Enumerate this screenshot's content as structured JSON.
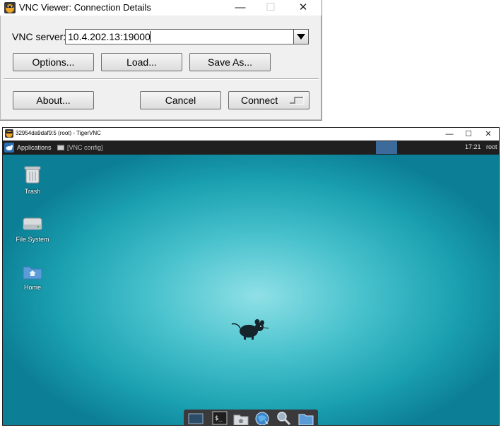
{
  "dialog": {
    "title": "VNC Viewer: Connection Details",
    "server_label": "VNC server:",
    "server_value": "10.4.202.13:19000",
    "options_label": "Options...",
    "load_label": "Load...",
    "save_as_label": "Save As...",
    "about_label": "About...",
    "cancel_label": "Cancel",
    "connect_label": "Connect",
    "minimize_glyph": "—",
    "maximize_glyph": "☐",
    "close_glyph": "✕"
  },
  "vnc_window": {
    "title": "32954da9daf9:5 (root) - TigerVNC",
    "minimize_glyph": "—",
    "maximize_glyph": "☐",
    "close_glyph": "✕"
  },
  "panel": {
    "applications_label": "Applications",
    "task_label": "[VNC config]",
    "clock": "17:21",
    "user": "root"
  },
  "desktop": {
    "icons": [
      {
        "label": "Trash",
        "icon": "trash-icon"
      },
      {
        "label": "File System",
        "icon": "drive-icon"
      },
      {
        "label": "Home",
        "icon": "folder-icon"
      }
    ]
  },
  "dock": {
    "items": [
      "desktop-icon",
      "terminal-icon",
      "file-manager-icon",
      "web-browser-icon",
      "search-icon",
      "folder-icon"
    ]
  },
  "colors": {
    "panel_bg": "#1f1f20",
    "workspace_active": "#3c6a9b",
    "desktop_teal": "#1aa0b0"
  }
}
